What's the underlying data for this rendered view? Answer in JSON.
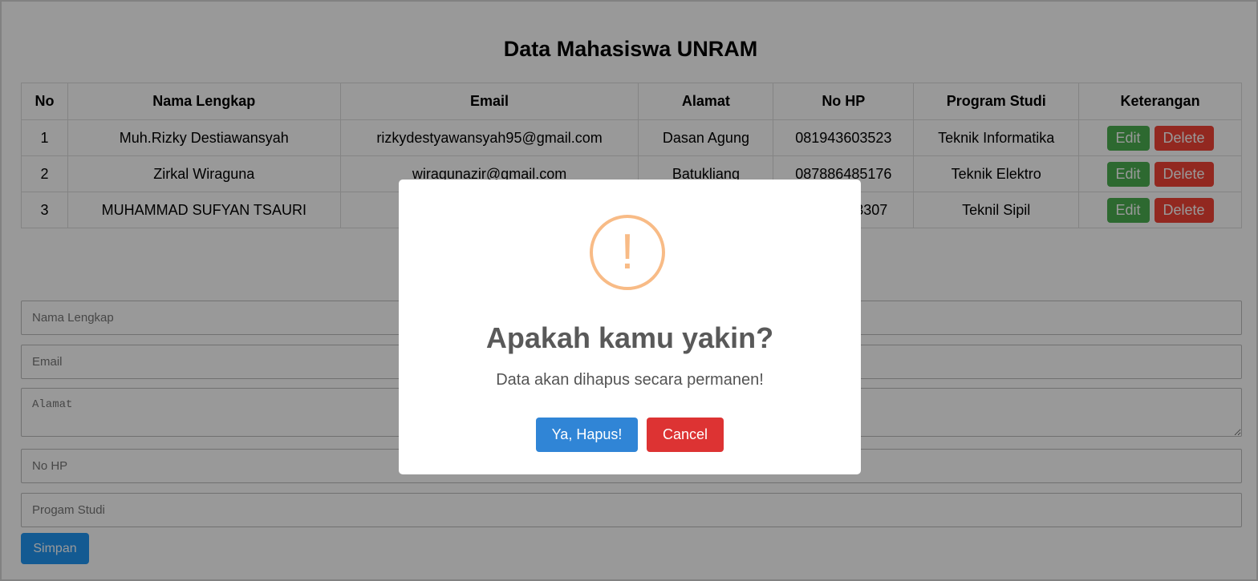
{
  "page": {
    "title": "Data Mahasiswa UNRAM"
  },
  "table": {
    "headers": [
      "No",
      "Nama Lengkap",
      "Email",
      "Alamat",
      "No HP",
      "Program Studi",
      "Keterangan"
    ],
    "rows": [
      {
        "no": "1",
        "nama": "Muh.Rizky Destiawansyah",
        "email": "rizkydestyawansyah95@gmail.com",
        "alamat": "Dasan Agung",
        "hp": "081943603523",
        "prodi": "Teknik Informatika"
      },
      {
        "no": "2",
        "nama": "Zirkal Wiraguna",
        "email": "wiragunazir@gmail.com",
        "alamat": "Batukliang",
        "hp": "087886485176",
        "prodi": "Teknik Elektro"
      },
      {
        "no": "3",
        "nama": "MUHAMMAD SUFYAN TSAURI",
        "email": "",
        "alamat": "",
        "hp": "3307",
        "prodi": "Teknil Sipil"
      }
    ],
    "edit_label": "Edit",
    "delete_label": "Delete"
  },
  "form": {
    "nama_placeholder": "Nama Lengkap",
    "email_placeholder": "Email",
    "alamat_placeholder": "Alamat",
    "hp_placeholder": "No HP",
    "prodi_placeholder": "Progam Studi",
    "submit_label": "Simpan"
  },
  "modal": {
    "icon": "exclamation-icon",
    "icon_glyph": "!",
    "title": "Apakah kamu yakin?",
    "text": "Data akan dihapus secara permanen!",
    "confirm_label": "Ya, Hapus!",
    "cancel_label": "Cancel"
  },
  "colors": {
    "edit": "#4caf50",
    "delete": "#f44336",
    "simpan": "#2196f3",
    "confirm": "#3085d6",
    "cancel": "#dd3333",
    "warning": "#f8bb86"
  }
}
